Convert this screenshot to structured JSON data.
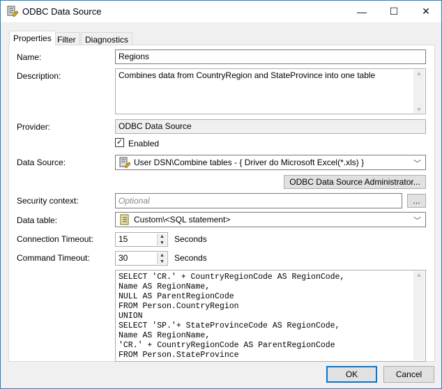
{
  "window": {
    "title": "ODBC Data Source",
    "minimize": "—",
    "maximize": "☐",
    "close": "✕"
  },
  "tabs": [
    {
      "label": "Properties"
    },
    {
      "label": "Filter"
    },
    {
      "label": "Diagnostics"
    }
  ],
  "form": {
    "name_label": "Name:",
    "name_value": "Regions",
    "description_label": "Description:",
    "description_value": "Combines data from CountryRegion and StateProvince into one table",
    "provider_label": "Provider:",
    "provider_value": "ODBC Data Source",
    "enabled_label": "Enabled",
    "enabled_checked": true,
    "data_source_label": "Data Source:",
    "data_source_value": "User DSN\\Combine tables - { Driver do Microsoft Excel(*.xls) }",
    "admin_button": "ODBC Data Source Administrator...",
    "security_label": "Security context:",
    "security_placeholder": "Optional",
    "browse_button": "...",
    "data_table_label": "Data table:",
    "data_table_value": "Custom\\<SQL statement>",
    "conn_timeout_label": "Connection Timeout:",
    "conn_timeout_value": "15",
    "conn_timeout_unit": "Seconds",
    "cmd_timeout_label": "Command Timeout:",
    "cmd_timeout_value": "30",
    "cmd_timeout_unit": "Seconds",
    "sql": "SELECT 'CR.' + CountryRegionCode AS RegionCode,\nName AS RegionName,\nNULL AS ParentRegionCode\nFROM Person.CountryRegion\nUNION\nSELECT 'SP.'+ StateProvinceCode AS RegionCode,\nName AS RegionName,\n'CR.' + CountryRegionCode AS ParentRegionCode\nFROM Person.StateProvince"
  },
  "buttons": {
    "ok": "OK",
    "cancel": "Cancel"
  },
  "colors": {
    "accent": "#1883d7",
    "panel": "#f0f0f0"
  }
}
